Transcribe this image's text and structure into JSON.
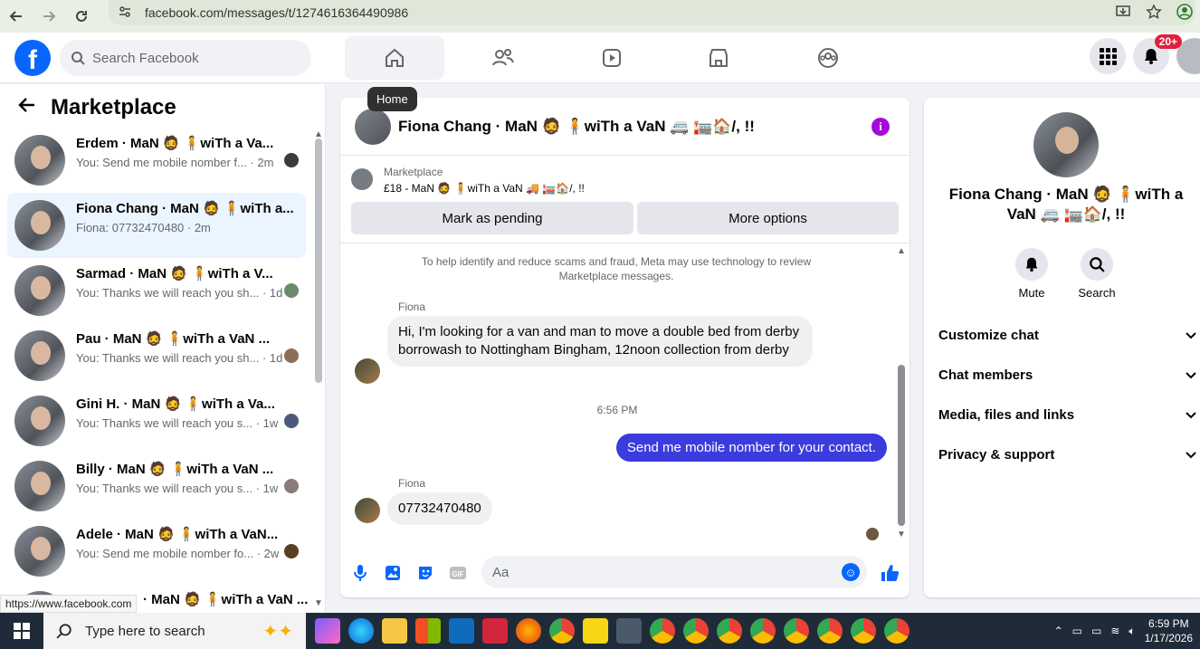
{
  "browser": {
    "url": "facebook.com/messages/t/1274616364490986"
  },
  "header": {
    "search_placeholder": "Search Facebook",
    "notification_badge": "20+",
    "tooltip": "Home"
  },
  "sidebar": {
    "title": "Marketplace",
    "conversations": [
      {
        "name": "Erdem · MaN 🧔 🧍wiTh a Va...",
        "preview": "You: Send me mobile nomber f... · 2m"
      },
      {
        "name": "Fiona Chang · MaN 🧔 🧍wiTh a...",
        "preview": "Fiona: 07732470480 · 2m"
      },
      {
        "name": "Sarmad · MaN 🧔 🧍wiTh a V...",
        "preview": "You: Thanks we will reach you sh... · 1d"
      },
      {
        "name": "Pau · MaN 🧔 🧍wiTh a VaN ...",
        "preview": "You: Thanks we will reach you sh... · 1d"
      },
      {
        "name": "Gini H. · MaN 🧔 🧍wiTh a Va...",
        "preview": "You: Thanks we will reach you s... · 1w"
      },
      {
        "name": "Billy · MaN 🧔 🧍wiTh a VaN ...",
        "preview": "You: Thanks we will reach you s... · 1w"
      },
      {
        "name": "Adele · MaN 🧔 🧍wiTh a VaN...",
        "preview": "You: Send me mobile nomber fo... · 2w"
      },
      {
        "name": "· MaN 🧔 🧍wiTh a VaN ...",
        "preview": ""
      }
    ],
    "status_url": "https://www.facebook.com"
  },
  "chat": {
    "title": "Fiona Chang · MaN 🧔 🧍wiTh a VaN 🚐 🏣🏠/, !!",
    "marketplace_label": "Marketplace",
    "marketplace_item": "£18 - MaN 🧔 🧍wiTh a VaN 🚚 🏣🏠/, !!",
    "mark_pending_label": "Mark as pending",
    "more_options_label": "More options",
    "notice": "To help identify and reduce scams and fraud, Meta may use technology to review Marketplace messages.",
    "sender_name": "Fiona",
    "message_1": "Hi, I'm looking for a van and man to move a double bed from derby borrowash to Nottingham Bingham, 12noon collection from derby",
    "timestamp": "6:56 PM",
    "message_2": "Send me mobile nomber for your contact.",
    "sender_name_2": "Fiona",
    "message_3": "07732470480",
    "composer_placeholder": "Aa"
  },
  "details": {
    "name": "Fiona Chang · MaN 🧔 🧍wiTh a VaN 🚐 🏣🏠/, !!",
    "mute_label": "Mute",
    "search_label": "Search",
    "sections": [
      "Customize chat",
      "Chat members",
      "Media, files and links",
      "Privacy & support"
    ]
  },
  "taskbar": {
    "search_placeholder": "Type here to search",
    "time": "6:59 PM",
    "date": "1/17/2026"
  },
  "colors": {
    "fb_blue": "#0866ff",
    "outgoing_bubble": "#3a3cdd",
    "info_purple": "#a40bd6",
    "badge_red": "#e41e3f"
  }
}
